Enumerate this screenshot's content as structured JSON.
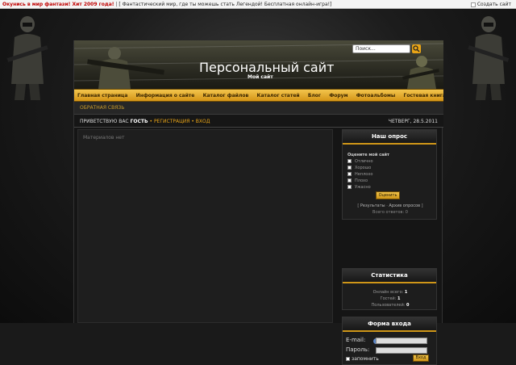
{
  "topbar": {
    "promo": "Окунись в мир фантази! Хит 2009 года!",
    "separator": "|",
    "ad_text": "[ Фантастический мир, где ты можешь стать Легендой! Бесплатная онлайн-игра!]",
    "create_site": "Создать сайт"
  },
  "header": {
    "title": "Персональный сайт",
    "subtitle": "Мой сайт",
    "search_placeholder": "Поиск..."
  },
  "nav": {
    "items": [
      "Главная страница",
      "Информация о сайте",
      "Каталог файлов",
      "Каталог статей",
      "Блог",
      "Форум",
      "Фотоальбомы",
      "Гостевая книга"
    ]
  },
  "subnav": {
    "feedback": "Обратная связь"
  },
  "welcome": {
    "greeting": "Приветствую Вас",
    "user": "Гость",
    "bullet": "•",
    "register": "Регистрация",
    "login": "Вход",
    "date": "Четверг, 28.5.2011"
  },
  "content": {
    "empty_msg": "Материалов нет"
  },
  "poll": {
    "title": "Наш опрос",
    "question": "Оцените мой сайт",
    "options": [
      "Отлично",
      "Хорошо",
      "Неплохо",
      "Плохо",
      "Ужасно"
    ],
    "vote_button": "Оценить",
    "bracket_open": "[",
    "results": "Результаты",
    "separator": "·",
    "archive": "Архив опросов",
    "bracket_close": "]",
    "total_label": "Всего ответов:",
    "total": "0"
  },
  "stats": {
    "title": "Статистика",
    "online_label": "Онлайн всего:",
    "online": "1",
    "guests_label": "Гостей:",
    "guests": "1",
    "users_label": "Пользователей:",
    "users": "0"
  },
  "login_form": {
    "title": "Форма входа",
    "email_label": "E-mail:",
    "password_label": "Пароль:",
    "remember": "запомнить",
    "go_button": "Вход",
    "info_icon": "i"
  },
  "colors": {
    "accent": "#eaa516",
    "nav_bg": "#d49416",
    "page_bg": "#1a1a1a",
    "promo_text": "#c00000"
  },
  "icons": [
    "search-icon",
    "info-icon",
    "create-site-icon"
  ]
}
